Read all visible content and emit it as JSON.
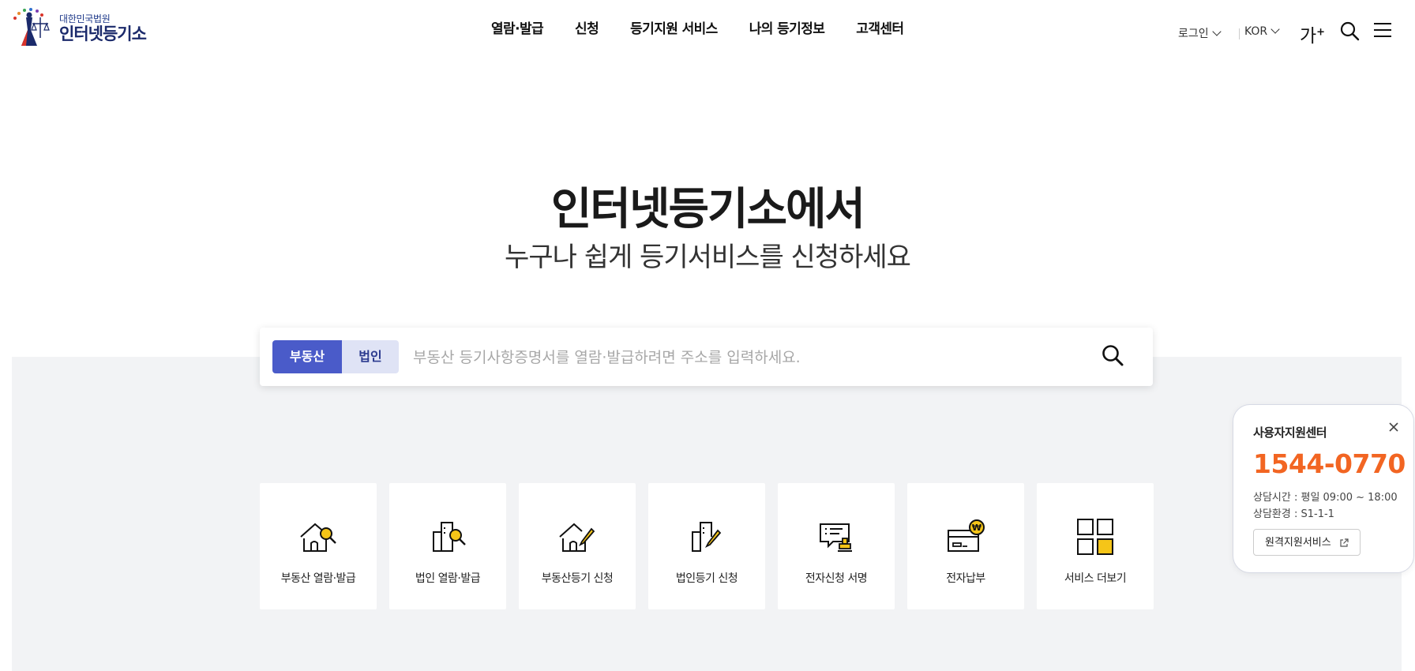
{
  "header": {
    "logo": {
      "small": "대한민국법원",
      "big": "인터넷등기소"
    },
    "nav": [
      "열람·발급",
      "신청",
      "등기지원 서비스",
      "나의 등기정보",
      "고객센터"
    ],
    "utils": {
      "login": "로그인",
      "language": "KOR",
      "font_size": "가"
    }
  },
  "hero": {
    "title": "인터넷등기소에서",
    "subtitle": "누구나 쉽게 등기서비스를 신청하세요"
  },
  "search": {
    "tabs": [
      "부동산",
      "법인"
    ],
    "active_tab": "부동산",
    "placeholder": "부동산 등기사항증명서를 열람·발급하려면 주소를 입력하세요.",
    "value": ""
  },
  "services": [
    {
      "label": "부동산 열람·발급",
      "icon": "house-search-icon"
    },
    {
      "label": "법인 열람·발급",
      "icon": "building-search-icon"
    },
    {
      "label": "부동산등기 신청",
      "icon": "house-pen-icon"
    },
    {
      "label": "법인등기 신청",
      "icon": "building-pen-icon"
    },
    {
      "label": "전자신청 서명",
      "icon": "e-sign-icon"
    },
    {
      "label": "전자납부",
      "icon": "e-payment-icon"
    },
    {
      "label": "서비스 더보기",
      "icon": "grid-more-icon"
    }
  ],
  "support": {
    "title": "사용자지원센터",
    "phone": "1544-0770",
    "hours": "상담시간 : 평일 09:00 ~ 18:00",
    "env": "상담환경 : S1-1-1",
    "remote_button": "원격지원서비스"
  },
  "colors": {
    "accent": "#4a5bc9",
    "accent_light": "#dfe3f5",
    "phone": "#f26522",
    "icon_yellow": "#f5c518",
    "band": "#f2f3f5"
  }
}
